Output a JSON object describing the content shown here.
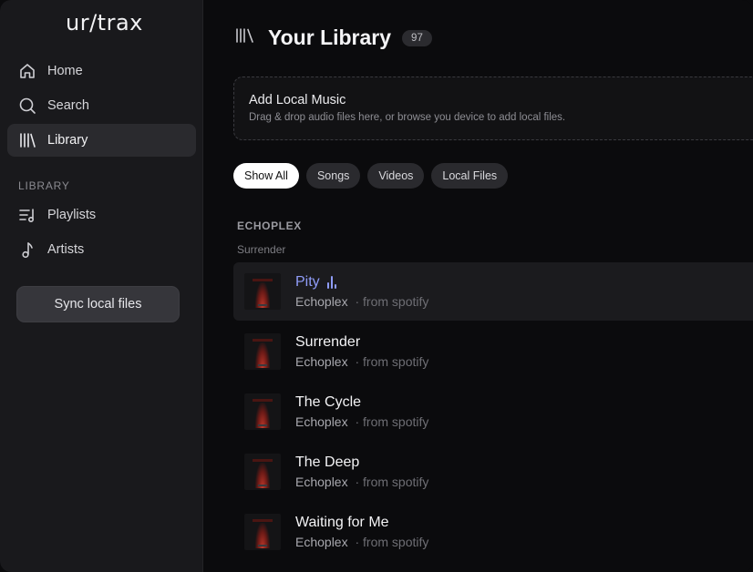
{
  "app": {
    "name": "ur/trax"
  },
  "sidebar": {
    "nav": [
      {
        "label": "Home",
        "icon": "home-icon"
      },
      {
        "label": "Search",
        "icon": "search-icon"
      },
      {
        "label": "Library",
        "icon": "library-icon",
        "active": true
      }
    ],
    "section_label": "LIBRARY",
    "library_items": [
      {
        "label": "Playlists",
        "icon": "playlist-icon"
      },
      {
        "label": "Artists",
        "icon": "music-note-icon"
      }
    ],
    "sync_button": "Sync local files"
  },
  "main": {
    "title": "Your Library",
    "count": "97",
    "dropzone": {
      "title": "Add Local Music",
      "subtitle": "Drag & drop audio files here, or browse you device to add local files."
    },
    "filters": [
      "Show All",
      "Songs",
      "Videos",
      "Local Files"
    ],
    "active_filter": "Show All",
    "group": {
      "artist": "ECHOPLEX",
      "album": "Surrender"
    },
    "tracks": [
      {
        "title": "Pity",
        "artist": "Echoplex",
        "source": "· from spotify",
        "playing": true
      },
      {
        "title": "Surrender",
        "artist": "Echoplex",
        "source": "· from spotify"
      },
      {
        "title": "The Cycle",
        "artist": "Echoplex",
        "source": "· from spotify"
      },
      {
        "title": "The Deep",
        "artist": "Echoplex",
        "source": "· from spotify"
      },
      {
        "title": "Waiting for Me",
        "artist": "Echoplex",
        "source": "· from spotify"
      }
    ]
  },
  "colors": {
    "accent": "#8f9cf8",
    "logo_gradient_start": "#5b7fe0",
    "logo_gradient_end": "#7fc4f0"
  }
}
